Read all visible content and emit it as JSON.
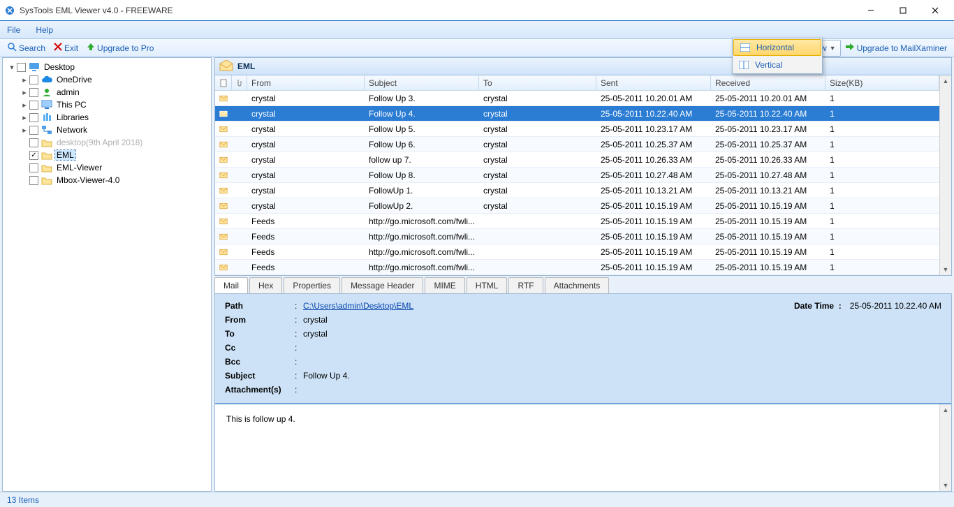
{
  "window": {
    "title": "SysTools EML Viewer v4.0 - FREEWARE"
  },
  "menu": {
    "file": "File",
    "help": "Help"
  },
  "toolbar": {
    "search": "Search",
    "exit": "Exit",
    "upgrade": "Upgrade to Pro",
    "switch": "Switch View",
    "mailx": "Upgrade to MailXaminer"
  },
  "switch_menu": {
    "horizontal": "Horizontal",
    "vertical": "Vertical"
  },
  "tree": {
    "root": "Desktop",
    "onedrive": "OneDrive",
    "admin": "admin",
    "thispc": "This PC",
    "libraries": "Libraries",
    "network": "Network",
    "desktopd": "desktop(9th April 2018)",
    "eml": "EML",
    "emlviewer": "EML-Viewer",
    "mbox": "Mbox-Viewer-4.0"
  },
  "panel": {
    "title": "EML"
  },
  "grid": {
    "headers": {
      "from": "From",
      "subject": "Subject",
      "to": "To",
      "sent": "Sent",
      "received": "Received",
      "size": "Size(KB)"
    },
    "rows": [
      {
        "from": "crystal",
        "subject": "Follow Up 3.",
        "to": "crystal",
        "sent": "25-05-2011 10.20.01 AM",
        "recv": "25-05-2011 10.20.01 AM",
        "size": "1"
      },
      {
        "from": "crystal",
        "subject": "Follow Up 4.",
        "to": "crystal",
        "sent": "25-05-2011 10.22.40 AM",
        "recv": "25-05-2011 10.22.40 AM",
        "size": "1",
        "selected": true
      },
      {
        "from": "crystal",
        "subject": "Follow Up 5.",
        "to": "crystal",
        "sent": "25-05-2011 10.23.17 AM",
        "recv": "25-05-2011 10.23.17 AM",
        "size": "1"
      },
      {
        "from": "crystal",
        "subject": "Follow Up 6.",
        "to": "crystal",
        "sent": "25-05-2011 10.25.37 AM",
        "recv": "25-05-2011 10.25.37 AM",
        "size": "1"
      },
      {
        "from": "crystal",
        "subject": "follow up 7.",
        "to": "crystal",
        "sent": "25-05-2011 10.26.33 AM",
        "recv": "25-05-2011 10.26.33 AM",
        "size": "1"
      },
      {
        "from": "crystal",
        "subject": "Follow Up 8.",
        "to": "crystal",
        "sent": "25-05-2011 10.27.48 AM",
        "recv": "25-05-2011 10.27.48 AM",
        "size": "1"
      },
      {
        "from": "crystal",
        "subject": "FollowUp 1.",
        "to": "crystal",
        "sent": "25-05-2011 10.13.21 AM",
        "recv": "25-05-2011 10.13.21 AM",
        "size": "1"
      },
      {
        "from": "crystal",
        "subject": "FollowUp 2.",
        "to": "crystal",
        "sent": "25-05-2011 10.15.19 AM",
        "recv": "25-05-2011 10.15.19 AM",
        "size": "1"
      },
      {
        "from": "Feeds",
        "subject": "http://go.microsoft.com/fwli...",
        "to": "",
        "sent": "25-05-2011 10.15.19 AM",
        "recv": "25-05-2011 10.15.19 AM",
        "size": "1"
      },
      {
        "from": "Feeds",
        "subject": "http://go.microsoft.com/fwli...",
        "to": "",
        "sent": "25-05-2011 10.15.19 AM",
        "recv": "25-05-2011 10.15.19 AM",
        "size": "1"
      },
      {
        "from": "Feeds",
        "subject": "http://go.microsoft.com/fwli...",
        "to": "",
        "sent": "25-05-2011 10.15.19 AM",
        "recv": "25-05-2011 10.15.19 AM",
        "size": "1"
      },
      {
        "from": "Feeds",
        "subject": "http://go.microsoft.com/fwli...",
        "to": "",
        "sent": "25-05-2011 10.15.19 AM",
        "recv": "25-05-2011 10.15.19 AM",
        "size": "1"
      }
    ]
  },
  "tabs": {
    "mail": "Mail",
    "hex": "Hex",
    "prop": "Properties",
    "header": "Message Header",
    "mime": "MIME",
    "html": "HTML",
    "rtf": "RTF",
    "att": "Attachments"
  },
  "preview": {
    "labels": {
      "path": "Path",
      "from": "From",
      "to": "To",
      "cc": "Cc",
      "bcc": "Bcc",
      "subject": "Subject",
      "attach": "Attachment(s)",
      "date": "Date Time"
    },
    "path": "C:\\Users\\admin\\Desktop\\EML",
    "from": "crystal",
    "to": "crystal",
    "cc": "",
    "bcc": "",
    "subject": "Follow Up 4.",
    "attach": "",
    "date": "25-05-2011 10.22.40 AM",
    "body": "This is follow up 4."
  },
  "status": {
    "text": "13 Items"
  }
}
